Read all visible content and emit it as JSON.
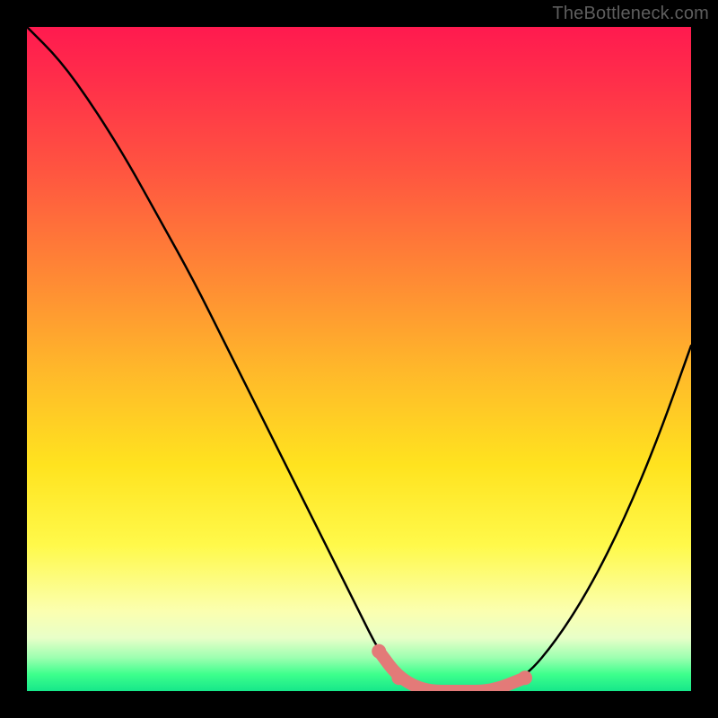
{
  "watermark": "TheBottleneck.com",
  "chart_data": {
    "type": "line",
    "title": "",
    "xlabel": "",
    "ylabel": "",
    "xlim": [
      0,
      100
    ],
    "ylim": [
      0,
      100
    ],
    "series": [
      {
        "name": "bottleneck-curve",
        "x": [
          0,
          5,
          10,
          15,
          20,
          25,
          30,
          35,
          40,
          45,
          50,
          53,
          56,
          60,
          65,
          70,
          75,
          80,
          85,
          90,
          95,
          100
        ],
        "values": [
          100,
          95,
          88,
          80,
          71,
          62,
          52,
          42,
          32,
          22,
          12,
          6,
          2,
          0,
          0,
          0,
          2,
          8,
          16,
          26,
          38,
          52
        ]
      }
    ],
    "highlight_band": {
      "name": "optimal-region",
      "x_start": 53,
      "x_end": 75,
      "color": "#e37a78"
    },
    "background_gradient": {
      "orientation": "vertical",
      "stops": [
        {
          "pos": 0,
          "color": "#ff1a4f"
        },
        {
          "pos": 0.22,
          "color": "#ff5640"
        },
        {
          "pos": 0.52,
          "color": "#ffb92a"
        },
        {
          "pos": 0.78,
          "color": "#fff94a"
        },
        {
          "pos": 0.92,
          "color": "#e8ffc8"
        },
        {
          "pos": 1.0,
          "color": "#16e78a"
        }
      ]
    }
  }
}
